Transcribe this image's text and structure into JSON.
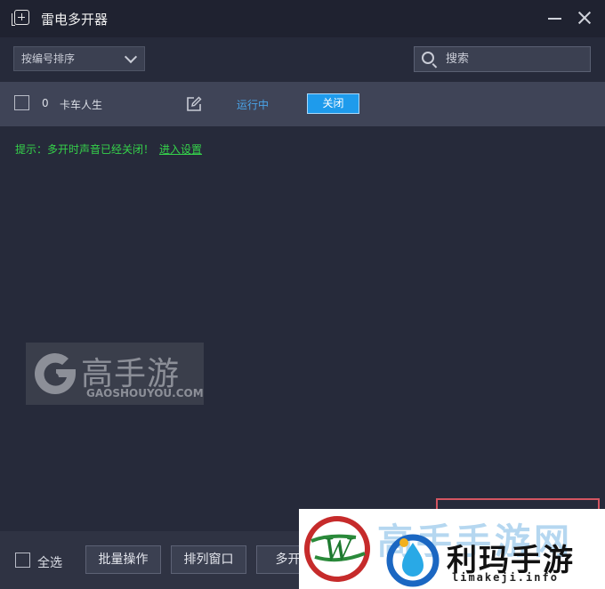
{
  "window": {
    "title": "雷电多开器",
    "icon": "add-window-icon",
    "controls": [
      "minimize-icon",
      "close-icon"
    ]
  },
  "toolbar": {
    "sort_select": {
      "value": "按编号排序"
    },
    "search": {
      "placeholder": "搜索"
    }
  },
  "instances": [
    {
      "index": "0",
      "name": "卡车人生",
      "status": "运行中",
      "action_label": "关闭",
      "checked": false
    }
  ],
  "notice": {
    "text": "提示：多开时声音已经关闭！",
    "link": "进入设置",
    "color": "#35d24a"
  },
  "footer": {
    "select_all_label": "全选",
    "buttons": [
      "批量操作",
      "排列窗口",
      "多开仿"
    ]
  },
  "watermarks": {
    "gaoshouyou": {
      "cn": "高手游",
      "en": "GAOSHOUYOU.COM"
    },
    "limakeji": {
      "back": "高手手游网",
      "cn": "利玛手游",
      "en": "limakeji.info"
    }
  },
  "colors": {
    "accent": "#1e9bec",
    "status": "#4aa4e8",
    "background": "#262a3a",
    "row": "#3f4457"
  }
}
